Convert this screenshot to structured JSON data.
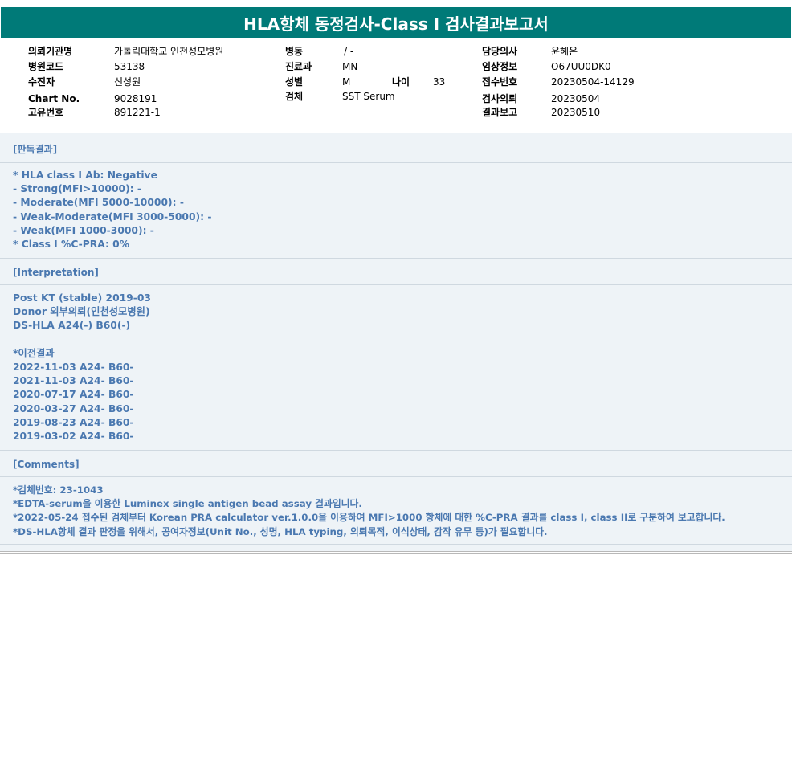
{
  "title": "HLA항체 동정검사-Class I 검사결과보고서",
  "patient": {
    "col1": [
      {
        "label": "의뢰기관명",
        "value": "가톨릭대학교 인천성모병원"
      },
      {
        "label": "병원코드",
        "value": "53138"
      },
      {
        "label": "수진자",
        "value": "신성원"
      },
      {
        "label": "Chart No.",
        "value": "9028191"
      },
      {
        "label": "고유번호",
        "value": "891221-1"
      }
    ],
    "col2": [
      {
        "label": "병동",
        "value": "/ -"
      },
      {
        "label": "진료과",
        "value": "MN"
      },
      {
        "label": "성별",
        "value": "M"
      },
      {
        "label": "검체",
        "value": "SST Serum"
      }
    ],
    "age": {
      "label": "나이",
      "value": "33"
    },
    "col3": [
      {
        "label": "담당의사",
        "value": "윤혜은"
      },
      {
        "label": "임상정보",
        "value": "O67UU0DK0"
      },
      {
        "label": "접수번호",
        "value": "20230504-14129"
      },
      {
        "label": "검사의뢰",
        "value": "20230504"
      },
      {
        "label": "결과보고",
        "value": "20230510"
      }
    ]
  },
  "sections": {
    "result_header": "[판독결과]",
    "result_lines": [
      "* HLA class I Ab: Negative",
      "- Strong(MFI>10000): -",
      "- Moderate(MFI 5000-10000): -",
      "- Weak-Moderate(MFI 3000-5000): -",
      "- Weak(MFI 1000-3000): -",
      "* Class I %C-PRA: 0%"
    ],
    "interp_header": "[Interpretation]",
    "interp_lines": [
      "Post KT (stable) 2019-03",
      "Donor 외부의뢰(인천성모병원)",
      "DS-HLA A24(-) B60(-)",
      "",
      "*이전결과",
      "2022-11-03 A24- B60-",
      "2021-11-03 A24- B60-",
      "2020-07-17 A24- B60-",
      "2020-03-27 A24- B60-",
      "2019-08-23 A24- B60-",
      "2019-03-02 A24- B60-"
    ],
    "comments_header": "[Comments]",
    "comments_lines": [
      "*검체번호: 23-1043",
      "*EDTA-serum을 이용한 Luminex single antigen bead assay 결과입니다.",
      "*2022-05-24 접수된 검체부터 Korean PRA calculator ver.1.0.0을 이용하여 MFI>1000 항체에 대한 %C-PRA 결과를 class I, class II로 구분하여 보고합니다.",
      "*DS-HLA항체 결과 판정을 위해서, 공여자정보(Unit No., 성명, HLA typing, 의뢰목적, 이식상태, 감작 유무 등)가 필요합니다."
    ]
  },
  "colors": {
    "title_bg": "#007a78",
    "text_blue": "#4a78b0",
    "report_bg": "#eef3f7"
  }
}
